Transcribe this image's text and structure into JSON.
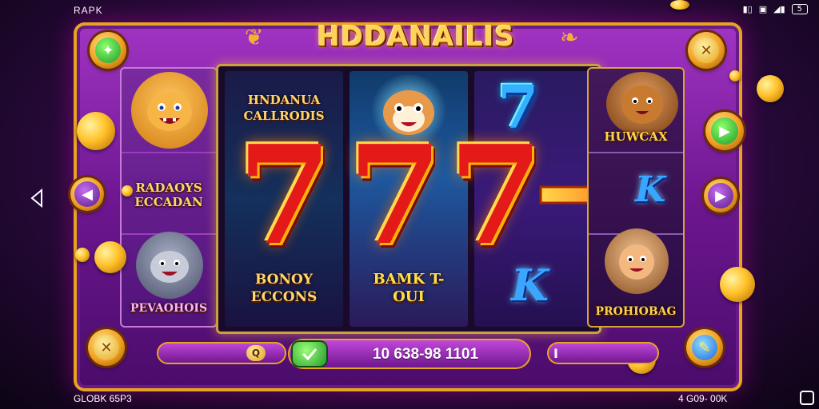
{
  "status_bar": {
    "left_text": "RAPK",
    "battery": "5",
    "bottom_left": "GLOBK 65P3",
    "bottom_right": "4 G09- 00K"
  },
  "game": {
    "title": "HDDANAILIS",
    "reels": {
      "reel1_top_label": "HNDANUA CALLRODIS",
      "reel1_bottom_label": "BONOY ECCONS",
      "reel2_bottom_label": "BAMK T-OUI",
      "sevens": [
        "7",
        "7",
        "7"
      ],
      "reel3_top_symbol": "7",
      "reel3_bottom_symbol": "K"
    },
    "left_column": {
      "middle_label": "RADAOYS ECCADAN",
      "bottom_label": "PEVAOHOIS"
    },
    "right_column": {
      "top_label": "HUWCAX",
      "middle_symbol": "K",
      "bottom_label": "PROHIOBAG"
    },
    "bottom_bar": {
      "left_chip": "Q",
      "balance": "10 638-98 1101",
      "right_text": "I"
    }
  },
  "colors": {
    "frame": "#a234c4",
    "gold": "#e6a51e",
    "seven_red": "#e41a18",
    "k_blue": "#39a6ff"
  },
  "icons": {
    "top_left_button": "wand-icon",
    "top_right_button": "tools-icon",
    "left_nav": "chevron-left-icon",
    "right_nav": "chevron-right-icon",
    "right_play": "play-icon",
    "bottom_left_button": "tools-icon",
    "bottom_right_button": "wand-icon",
    "check": "check-icon"
  }
}
